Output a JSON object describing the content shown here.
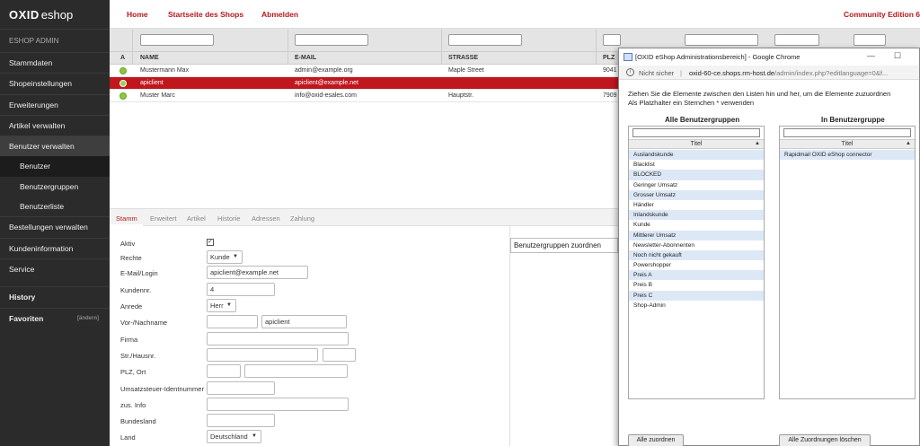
{
  "brand": {
    "logo_main": "OXID",
    "logo_sub": "eshop",
    "admin_label": "ESHOP ADMIN"
  },
  "sidebar": {
    "items": [
      {
        "label": "Stammdaten"
      },
      {
        "label": "Shopeinstellungen"
      },
      {
        "label": "Erweiterungen"
      },
      {
        "label": "Artikel verwalten"
      },
      {
        "label": "Benutzer verwalten"
      }
    ],
    "sub_items": [
      {
        "label": "Benutzer"
      },
      {
        "label": "Benutzergruppen"
      },
      {
        "label": "Benutzerliste"
      }
    ],
    "items_after": [
      {
        "label": "Bestellungen verwalten"
      },
      {
        "label": "Kundeninformation"
      },
      {
        "label": "Service"
      }
    ],
    "history": "History",
    "favorites": "Favoriten",
    "favorites_change": "[ändern]"
  },
  "topbar": {
    "home": "Home",
    "start": "Startseite des Shops",
    "logout": "Abmelden",
    "edition": "Community Edition 6"
  },
  "list": {
    "headers": {
      "a": "A",
      "name": "NAME",
      "email": "E-MAIL",
      "street": "STRASSE",
      "zip": "PLZ"
    },
    "rows": [
      {
        "name": "Mustermann Max",
        "email": "admin@example.org",
        "street": "Maple Street",
        "zip": "9041"
      },
      {
        "name": "apiclient",
        "email": "apiclient@example.net",
        "street": "",
        "zip": ""
      },
      {
        "name": "Muster Marc",
        "email": "info@oxid-esales.com",
        "street": "Hauptstr.",
        "zip": "7909"
      }
    ]
  },
  "tabs": [
    "Stamm",
    "Erweitert",
    "Artikel",
    "Historie",
    "Adressen",
    "Zahlung"
  ],
  "form": {
    "labels": {
      "active": "Aktiv",
      "rights": "Rechte",
      "email": "E-Mail/Login",
      "customer_no": "Kundennr.",
      "salutation": "Anrede",
      "name": "Vor-/Nachname",
      "company": "Firma",
      "street": "Str./Hausnr.",
      "zip_city": "PLZ, Ort",
      "vat": "Umsatzsteuer-Identnummer",
      "add_info": "zus. Info",
      "state": "Bundesland",
      "country": "Land"
    },
    "values": {
      "rights": "Kunde",
      "email": "apiclient@example.net",
      "customer_no": "4",
      "salutation": "Herr",
      "lastname": "apiclient",
      "country": "Deutschland"
    },
    "assign_button": "Benutzergruppen zuordnen"
  },
  "popup": {
    "title": "[OXID eShop Administrationsbereich] - Google Chrome",
    "not_secure": "Nicht sicher",
    "url": "oxid-60-ce.shops.rm-host.de",
    "url_path": "/admin/index.php?editlanguage=0&f...",
    "instructions_1": "Ziehen Sie die Elemente zwischen den Listen hin und her, um die Elemente zuzuordnen",
    "instructions_2": "Als Platzhalter ein Sternchen * verwenden",
    "left_title": "Alle Benutzergruppen",
    "right_title": "In Benutzergruppe",
    "col_title": "Titel",
    "left_items": [
      "Auslandskunde",
      "Blacklist",
      "BLOCKED",
      "Geringer Umsatz",
      "Grosser Umsatz",
      "Händler",
      "Inlandskunde",
      "Kunde",
      "Mittlerer Umsatz",
      "Newsletter-Abonnenten",
      "Noch nicht gekauft",
      "Powershopper",
      "Preis A",
      "Preis B",
      "Preis C",
      "Shop-Admin"
    ],
    "right_items": [
      "Rapidmail OXID eShop connector"
    ],
    "assign_all": "Alle zuordnen",
    "remove_all": "Alle Zuordnungen löschen"
  }
}
